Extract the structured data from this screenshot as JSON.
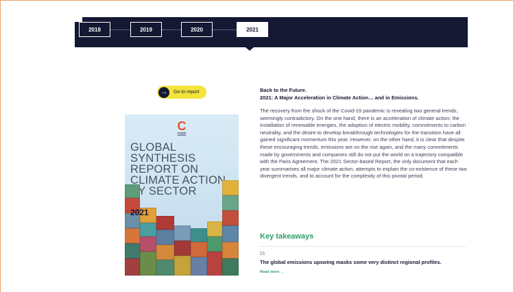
{
  "timeline": {
    "years": [
      {
        "label": "2018",
        "active": false
      },
      {
        "label": "2019",
        "active": false
      },
      {
        "label": "2020",
        "active": false
      },
      {
        "label": "2021",
        "active": true
      }
    ]
  },
  "report_button": {
    "label": "Go to report",
    "icon": "arrow-right-icon"
  },
  "cover": {
    "org_mark": "C",
    "org_text": "CLIMATE CHANCE",
    "title": "GLOBAL SYNTHESIS REPORT ON CLIMATE ACTION BY SECTOR",
    "year": "2021"
  },
  "article": {
    "heading_line1": "Back to the Future.",
    "heading_line2": "2021: A Major Acceleration in Climate Action… and in Emissions.",
    "body": "The recovery from the shock of the Covid-19 pandemic is revealing two general trends, seemingly contradictory. On the one hand, there is an acceleration of climate action: the installation of renewable energies, the adoption of electric mobility, commitments to carbon neutrality, and the desire to develop breakthrough technologies for the transition have all gained significant momentum this year. However, on the other hand, it is clear that despite these encouraging trends, emissions are on the rise again, and the many commitments made by governments and companies still do not put the world on a trajectory compatible with the Paris Agreement. The 2021 Sector-based Report, the only document that each year summarises all major climate action, attempts to explain the co-existence of these two divergent trends, and to account for the complexity of this pivotal period."
  },
  "key_takeaways": {
    "title": "Key takeaways",
    "items": [
      {
        "number": "01",
        "text": "The global emissions upswing masks some very distinct regional profiles.",
        "link": "Read more →"
      }
    ]
  },
  "colors": {
    "navy": "#151833",
    "accent_yellow": "#f3e43a",
    "accent_green": "#2f9e6a",
    "frame_orange": "#e8a06a"
  }
}
